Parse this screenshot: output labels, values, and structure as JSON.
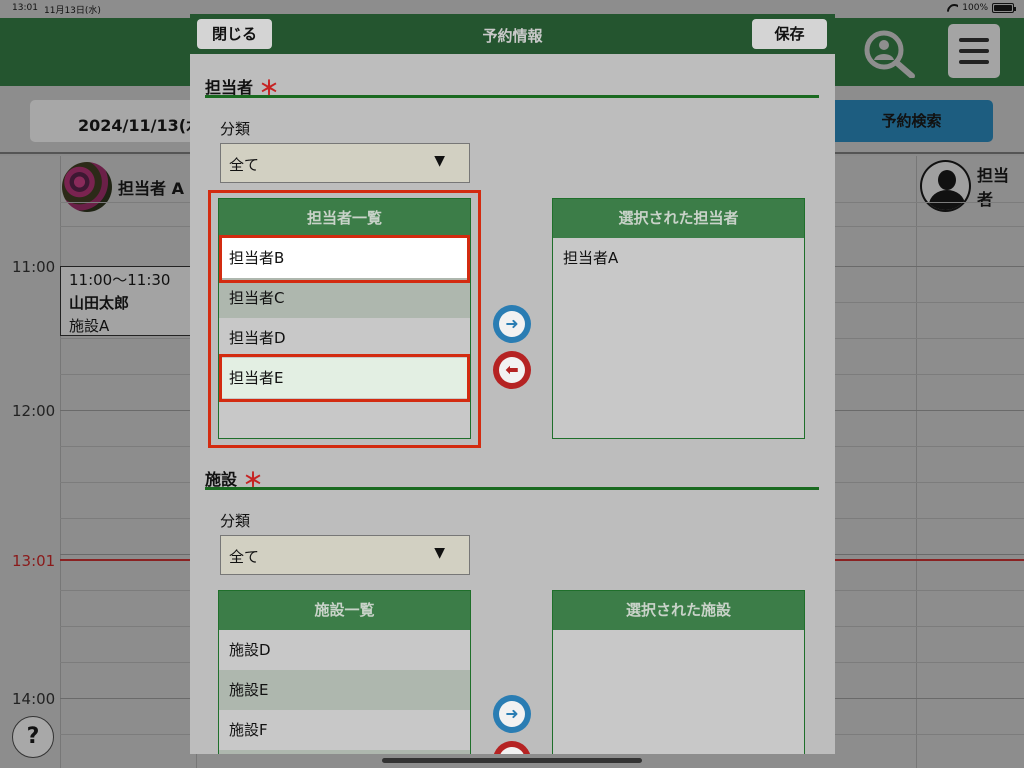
{
  "status_bar": {
    "time": "13:01",
    "date": "11月13日(水)",
    "battery": "100%"
  },
  "background": {
    "date_button": "2024/11/13(水",
    "reservation_search_button": "予約検索",
    "staff_a_name": "担当者 A",
    "staff_right_name": "担当者",
    "time_labels": [
      "11:00",
      "12:00",
      "13:01",
      "14:00"
    ],
    "appointment": {
      "time": "11:00～11:30",
      "name": "山田太郎",
      "facility": "施設A"
    },
    "help_button": "?"
  },
  "modal": {
    "title": "予約情報",
    "close_button": "閉じる",
    "save_button": "保存",
    "staff_section": {
      "title": "担当者",
      "required_mark": "＊",
      "category_label": "分類",
      "category_value": "全て",
      "list_title": "担当者一覧",
      "list_items": [
        "担当者B",
        "担当者C",
        "担当者D",
        "担当者E"
      ],
      "selected_title": "選択された担当者",
      "selected_items": [
        "担当者A"
      ]
    },
    "facility_section": {
      "title": "施設",
      "required_mark": "＊",
      "category_label": "分類",
      "category_value": "全て",
      "list_title": "施設一覧",
      "list_items": [
        "施設D",
        "施設E",
        "施設F"
      ],
      "selected_title": "選択された施設",
      "selected_items": []
    }
  },
  "colors": {
    "header_green": "#24552f",
    "list_header_green": "#3c7d48",
    "highlight_red": "#d32b10",
    "add_arrow_blue": "#2a7db3",
    "remove_arrow_red": "#b52323"
  },
  "icons": {
    "add": "arrow-right-icon",
    "remove": "arrow-left-icon",
    "menu": "hamburger-icon",
    "search_user": "user-search-icon",
    "select_caret": "triangle-down-icon"
  }
}
